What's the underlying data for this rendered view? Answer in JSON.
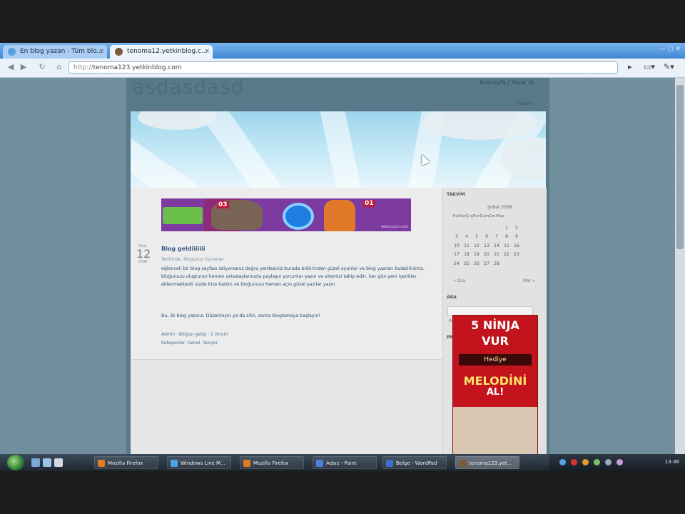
{
  "browser": {
    "tabs": [
      {
        "label": "En blog yazan - Tüm blo...",
        "active": false
      },
      {
        "label": "tenoma12.yetkinblog.c...",
        "active": true
      }
    ],
    "url_scheme": "http://",
    "url_host": "tenoma123.yetkinblog.com",
    "window_controls": "— □ ✕"
  },
  "blog": {
    "site_title": "asdasdasd",
    "top_links": "Anasayfa | Yazar ol",
    "search_link": "Arama",
    "post": {
      "month": "Mart",
      "day": "12",
      "year": "2008",
      "title": "Blog geldiiiiiii",
      "meta": "Tarihinde, Blogunuz Oynanan",
      "body": "eğlenceli bir blog sayfası istiyorsanız doğru yerdesiniz burada birbirinden güzel oyunlar ve blog yazıları bulabilirsiniz. bloğunuzu oluşturun hemen arkadaşlarınızla paylaşın yorumlar yazın ve sitemizi takip edin. her gün yeni içerikler eklenmektedir sizde bize katılın ve bloğunuzu hemen açın güzel yazılar yazın",
      "body2": "Bu, ilk blog yazınız. Düzenleyin ya da silin, sonra bloglamaya başlayın!",
      "foot1": "Admin · Bloğun gelişi · 1 Yorum",
      "foot2": "Kategoriler: Genel, Yazıyor"
    },
    "banner": {
      "num1": "03",
      "num2": "01",
      "tag": "www.oyun.com"
    },
    "sidebar": {
      "calendar_title": "TAKVİM",
      "calendar_caption": "Şubat 2008",
      "calendar_header": "PzrSalÇrşPerCumCmtPaz",
      "calendar_rows": [
        [
          "",
          "",
          "",
          "",
          "",
          "1",
          "2"
        ],
        [
          "3",
          "4",
          "5",
          "6",
          "7",
          "8",
          "9"
        ],
        [
          "10",
          "11",
          "12",
          "13",
          "14",
          "15",
          "16"
        ],
        [
          "17",
          "18",
          "19",
          "20",
          "21",
          "22",
          "23"
        ],
        [
          "24",
          "25",
          "26",
          "27",
          "28",
          "",
          ""
        ]
      ],
      "cal_prev": "« Oca",
      "cal_next": "Mar »",
      "search_title": "ARA",
      "search_button": "Ara",
      "ads_title": "REKLAM"
    },
    "ad": {
      "line1": "5 NİNJA",
      "line2": "VUR",
      "band": "Hediye",
      "line3": "MELODİNİ",
      "line4": "AL!"
    }
  },
  "taskbar": {
    "items": [
      {
        "label": "Mozilla Firefox",
        "active": false
      },
      {
        "label": "Windows Live M...",
        "active": false
      },
      {
        "label": "Mozilla Firefox",
        "active": false
      },
      {
        "label": "Adsız - Paint",
        "active": false
      },
      {
        "label": "Belge - WordPad",
        "active": false
      },
      {
        "label": "tenoma123.yet...",
        "active": true
      }
    ],
    "clock": "13:46"
  }
}
